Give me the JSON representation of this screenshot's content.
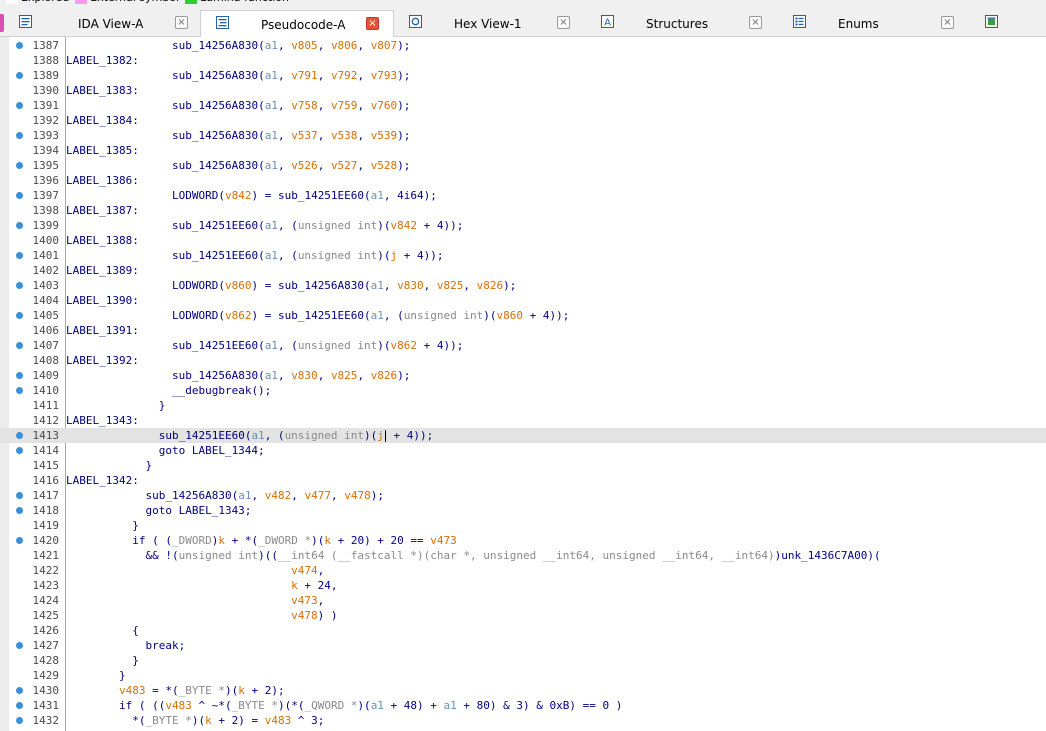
{
  "legend": {
    "items": [
      {
        "label": "Explored",
        "color": "#ffffff"
      },
      {
        "label": "External symbol",
        "color": "#ff99ee"
      },
      {
        "label": "Lumina function",
        "color": "#33cc33"
      }
    ]
  },
  "tabs": [
    {
      "label": "IDA View-A",
      "icon": "disassembly-view-icon",
      "active": false,
      "close": "×"
    },
    {
      "label": "Pseudocode-A",
      "icon": "pseudocode-icon",
      "active": true,
      "close": "×"
    },
    {
      "label": "Hex View-1",
      "icon": "hex-view-icon",
      "active": false,
      "close": "×"
    },
    {
      "label": "Structures",
      "icon": "structures-icon",
      "active": false,
      "close": "×"
    },
    {
      "label": "Enums",
      "icon": "enums-icon",
      "active": false,
      "close": "×"
    },
    {
      "label": "",
      "icon": "imports-icon",
      "active": false,
      "close": ""
    }
  ],
  "colors": {
    "dot": "#3b8fd6",
    "code": "#000080",
    "variable": "#d86e00",
    "argument": "#6a8fb8",
    "type": "#8a8a8a",
    "active_close": "#e8503a"
  },
  "code": {
    "highlighted_line": "1413",
    "lines": [
      {
        "ln": "1387",
        "dot": true,
        "tokens": [
          {
            "t": "                "
          },
          {
            "t": "sub_14256A830"
          },
          {
            "t": "("
          },
          {
            "t": "a1",
            "c": "a"
          },
          {
            "t": ", "
          },
          {
            "t": "v805",
            "c": "v"
          },
          {
            "t": ", "
          },
          {
            "t": "v806",
            "c": "v"
          },
          {
            "t": ", "
          },
          {
            "t": "v807",
            "c": "v"
          },
          {
            "t": ");"
          }
        ]
      },
      {
        "ln": "1388",
        "dot": false,
        "tokens": [
          {
            "t": "LABEL_1382:"
          }
        ]
      },
      {
        "ln": "1389",
        "dot": true,
        "tokens": [
          {
            "t": "                "
          },
          {
            "t": "sub_14256A830"
          },
          {
            "t": "("
          },
          {
            "t": "a1",
            "c": "a"
          },
          {
            "t": ", "
          },
          {
            "t": "v791",
            "c": "v"
          },
          {
            "t": ", "
          },
          {
            "t": "v792",
            "c": "v"
          },
          {
            "t": ", "
          },
          {
            "t": "v793",
            "c": "v"
          },
          {
            "t": ");"
          }
        ]
      },
      {
        "ln": "1390",
        "dot": false,
        "tokens": [
          {
            "t": "LABEL_1383:"
          }
        ]
      },
      {
        "ln": "1391",
        "dot": true,
        "tokens": [
          {
            "t": "                "
          },
          {
            "t": "sub_14256A830"
          },
          {
            "t": "("
          },
          {
            "t": "a1",
            "c": "a"
          },
          {
            "t": ", "
          },
          {
            "t": "v758",
            "c": "v"
          },
          {
            "t": ", "
          },
          {
            "t": "v759",
            "c": "v"
          },
          {
            "t": ", "
          },
          {
            "t": "v760",
            "c": "v"
          },
          {
            "t": ");"
          }
        ]
      },
      {
        "ln": "1392",
        "dot": false,
        "tokens": [
          {
            "t": "LABEL_1384:"
          }
        ]
      },
      {
        "ln": "1393",
        "dot": true,
        "tokens": [
          {
            "t": "                "
          },
          {
            "t": "sub_14256A830"
          },
          {
            "t": "("
          },
          {
            "t": "a1",
            "c": "a"
          },
          {
            "t": ", "
          },
          {
            "t": "v537",
            "c": "v"
          },
          {
            "t": ", "
          },
          {
            "t": "v538",
            "c": "v"
          },
          {
            "t": ", "
          },
          {
            "t": "v539",
            "c": "v"
          },
          {
            "t": ");"
          }
        ]
      },
      {
        "ln": "1394",
        "dot": false,
        "tokens": [
          {
            "t": "LABEL_1385:"
          }
        ]
      },
      {
        "ln": "1395",
        "dot": true,
        "tokens": [
          {
            "t": "                "
          },
          {
            "t": "sub_14256A830"
          },
          {
            "t": "("
          },
          {
            "t": "a1",
            "c": "a"
          },
          {
            "t": ", "
          },
          {
            "t": "v526",
            "c": "v"
          },
          {
            "t": ", "
          },
          {
            "t": "v527",
            "c": "v"
          },
          {
            "t": ", "
          },
          {
            "t": "v528",
            "c": "v"
          },
          {
            "t": ");"
          }
        ]
      },
      {
        "ln": "1396",
        "dot": false,
        "tokens": [
          {
            "t": "LABEL_1386:"
          }
        ]
      },
      {
        "ln": "1397",
        "dot": true,
        "tokens": [
          {
            "t": "                "
          },
          {
            "t": "LODWORD("
          },
          {
            "t": "v842",
            "c": "v"
          },
          {
            "t": ") = "
          },
          {
            "t": "sub_14251EE60"
          },
          {
            "t": "("
          },
          {
            "t": "a1",
            "c": "a"
          },
          {
            "t": ", 4i64);"
          }
        ]
      },
      {
        "ln": "1398",
        "dot": false,
        "tokens": [
          {
            "t": "LABEL_1387:"
          }
        ]
      },
      {
        "ln": "1399",
        "dot": true,
        "tokens": [
          {
            "t": "                "
          },
          {
            "t": "sub_14251EE60"
          },
          {
            "t": "("
          },
          {
            "t": "a1",
            "c": "a"
          },
          {
            "t": ", ("
          },
          {
            "t": "unsigned int",
            "c": "g"
          },
          {
            "t": ")("
          },
          {
            "t": "v842",
            "c": "v"
          },
          {
            "t": " + 4));"
          }
        ]
      },
      {
        "ln": "1400",
        "dot": false,
        "tokens": [
          {
            "t": "LABEL_1388:"
          }
        ]
      },
      {
        "ln": "1401",
        "dot": true,
        "tokens": [
          {
            "t": "                "
          },
          {
            "t": "sub_14251EE60"
          },
          {
            "t": "("
          },
          {
            "t": "a1",
            "c": "a"
          },
          {
            "t": ", ("
          },
          {
            "t": "unsigned int",
            "c": "g"
          },
          {
            "t": ")("
          },
          {
            "t": "j",
            "c": "v"
          },
          {
            "t": " + 4));"
          }
        ]
      },
      {
        "ln": "1402",
        "dot": false,
        "tokens": [
          {
            "t": "LABEL_1389:"
          }
        ]
      },
      {
        "ln": "1403",
        "dot": true,
        "tokens": [
          {
            "t": "                "
          },
          {
            "t": "LODWORD("
          },
          {
            "t": "v860",
            "c": "v"
          },
          {
            "t": ") = "
          },
          {
            "t": "sub_14256A830"
          },
          {
            "t": "("
          },
          {
            "t": "a1",
            "c": "a"
          },
          {
            "t": ", "
          },
          {
            "t": "v830",
            "c": "v"
          },
          {
            "t": ", "
          },
          {
            "t": "v825",
            "c": "v"
          },
          {
            "t": ", "
          },
          {
            "t": "v826",
            "c": "v"
          },
          {
            "t": ");"
          }
        ]
      },
      {
        "ln": "1404",
        "dot": false,
        "tokens": [
          {
            "t": "LABEL_1390:"
          }
        ]
      },
      {
        "ln": "1405",
        "dot": true,
        "tokens": [
          {
            "t": "                "
          },
          {
            "t": "LODWORD("
          },
          {
            "t": "v862",
            "c": "v"
          },
          {
            "t": ") = "
          },
          {
            "t": "sub_14251EE60"
          },
          {
            "t": "("
          },
          {
            "t": "a1",
            "c": "a"
          },
          {
            "t": ", ("
          },
          {
            "t": "unsigned int",
            "c": "g"
          },
          {
            "t": ")("
          },
          {
            "t": "v860",
            "c": "v"
          },
          {
            "t": " + 4));"
          }
        ]
      },
      {
        "ln": "1406",
        "dot": false,
        "tokens": [
          {
            "t": "LABEL_1391:"
          }
        ]
      },
      {
        "ln": "1407",
        "dot": true,
        "tokens": [
          {
            "t": "                "
          },
          {
            "t": "sub_14251EE60"
          },
          {
            "t": "("
          },
          {
            "t": "a1",
            "c": "a"
          },
          {
            "t": ", ("
          },
          {
            "t": "unsigned int",
            "c": "g"
          },
          {
            "t": ")("
          },
          {
            "t": "v862",
            "c": "v"
          },
          {
            "t": " + 4));"
          }
        ]
      },
      {
        "ln": "1408",
        "dot": false,
        "tokens": [
          {
            "t": "LABEL_1392:"
          }
        ]
      },
      {
        "ln": "1409",
        "dot": true,
        "tokens": [
          {
            "t": "                "
          },
          {
            "t": "sub_14256A830"
          },
          {
            "t": "("
          },
          {
            "t": "a1",
            "c": "a"
          },
          {
            "t": ", "
          },
          {
            "t": "v830",
            "c": "v"
          },
          {
            "t": ", "
          },
          {
            "t": "v825",
            "c": "v"
          },
          {
            "t": ", "
          },
          {
            "t": "v826",
            "c": "v"
          },
          {
            "t": ");"
          }
        ]
      },
      {
        "ln": "1410",
        "dot": true,
        "tokens": [
          {
            "t": "                "
          },
          {
            "t": "__debugbreak();"
          }
        ]
      },
      {
        "ln": "1411",
        "dot": false,
        "tokens": [
          {
            "t": "              }"
          }
        ]
      },
      {
        "ln": "1412",
        "dot": false,
        "tokens": [
          {
            "t": "LABEL_1343:"
          }
        ]
      },
      {
        "ln": "1413",
        "dot": true,
        "tokens": [
          {
            "t": "              "
          },
          {
            "t": "sub_14251EE60"
          },
          {
            "t": "("
          },
          {
            "t": "a1",
            "c": "a"
          },
          {
            "t": ", ("
          },
          {
            "t": "unsigned int",
            "c": "g"
          },
          {
            "t": ")("
          },
          {
            "t": "j",
            "c": "v"
          },
          {
            "t": "",
            "caret": true
          },
          {
            "t": " + 4));"
          }
        ]
      },
      {
        "ln": "1414",
        "dot": true,
        "tokens": [
          {
            "t": "              goto LABEL_1344;"
          }
        ]
      },
      {
        "ln": "1415",
        "dot": false,
        "tokens": [
          {
            "t": "            }"
          }
        ]
      },
      {
        "ln": "1416",
        "dot": false,
        "tokens": [
          {
            "t": "LABEL_1342:"
          }
        ]
      },
      {
        "ln": "1417",
        "dot": true,
        "tokens": [
          {
            "t": "            "
          },
          {
            "t": "sub_14256A830"
          },
          {
            "t": "("
          },
          {
            "t": "a1",
            "c": "a"
          },
          {
            "t": ", "
          },
          {
            "t": "v482",
            "c": "v"
          },
          {
            "t": ", "
          },
          {
            "t": "v477",
            "c": "v"
          },
          {
            "t": ", "
          },
          {
            "t": "v478",
            "c": "v"
          },
          {
            "t": ");"
          }
        ]
      },
      {
        "ln": "1418",
        "dot": true,
        "tokens": [
          {
            "t": "            goto LABEL_1343;"
          }
        ]
      },
      {
        "ln": "1419",
        "dot": false,
        "tokens": [
          {
            "t": "          }"
          }
        ]
      },
      {
        "ln": "1420",
        "dot": true,
        "tokens": [
          {
            "t": "          if ( ("
          },
          {
            "t": "_DWORD",
            "c": "g"
          },
          {
            "t": ")"
          },
          {
            "t": "k",
            "c": "v"
          },
          {
            "t": " + *("
          },
          {
            "t": "_DWORD *",
            "c": "g"
          },
          {
            "t": ")("
          },
          {
            "t": "k",
            "c": "v"
          },
          {
            "t": " + 20) + 20 == "
          },
          {
            "t": "v473",
            "c": "v"
          }
        ]
      },
      {
        "ln": "1421",
        "dot": false,
        "tokens": [
          {
            "t": "            && !("
          },
          {
            "t": "unsigned int",
            "c": "g"
          },
          {
            "t": ")(("
          },
          {
            "t": "__int64 (__fastcall *)(char *, unsigned __int64, unsigned __int64, __int64)",
            "c": "g"
          },
          {
            "t": ")unk_1436C7A00)("
          }
        ]
      },
      {
        "ln": "1422",
        "dot": false,
        "tokens": [
          {
            "t": "                                  "
          },
          {
            "t": "v474",
            "c": "v"
          },
          {
            "t": ","
          }
        ]
      },
      {
        "ln": "1423",
        "dot": false,
        "tokens": [
          {
            "t": "                                  "
          },
          {
            "t": "k",
            "c": "v"
          },
          {
            "t": " + 24,"
          }
        ]
      },
      {
        "ln": "1424",
        "dot": false,
        "tokens": [
          {
            "t": "                                  "
          },
          {
            "t": "v473",
            "c": "v"
          },
          {
            "t": ","
          }
        ]
      },
      {
        "ln": "1425",
        "dot": false,
        "tokens": [
          {
            "t": "                                  "
          },
          {
            "t": "v478",
            "c": "v"
          },
          {
            "t": ") )"
          }
        ]
      },
      {
        "ln": "1426",
        "dot": false,
        "tokens": [
          {
            "t": "          {"
          }
        ]
      },
      {
        "ln": "1427",
        "dot": true,
        "tokens": [
          {
            "t": "            break;"
          }
        ]
      },
      {
        "ln": "1428",
        "dot": false,
        "tokens": [
          {
            "t": "          }"
          }
        ]
      },
      {
        "ln": "1429",
        "dot": false,
        "tokens": [
          {
            "t": "        }"
          }
        ]
      },
      {
        "ln": "1430",
        "dot": true,
        "tokens": [
          {
            "t": "        "
          },
          {
            "t": "v483",
            "c": "v"
          },
          {
            "t": " = *("
          },
          {
            "t": "_BYTE *",
            "c": "g"
          },
          {
            "t": ")("
          },
          {
            "t": "k",
            "c": "v"
          },
          {
            "t": " + 2);"
          }
        ]
      },
      {
        "ln": "1431",
        "dot": true,
        "tokens": [
          {
            "t": "        if ( (("
          },
          {
            "t": "v483",
            "c": "v"
          },
          {
            "t": " ^ ~*("
          },
          {
            "t": "_BYTE *",
            "c": "g"
          },
          {
            "t": ")(*("
          },
          {
            "t": "_QWORD *",
            "c": "g"
          },
          {
            "t": ")("
          },
          {
            "t": "a1",
            "c": "a"
          },
          {
            "t": " + 48) + "
          },
          {
            "t": "a1",
            "c": "a"
          },
          {
            "t": " + 80) & 3) & 0xB) == 0 )"
          }
        ]
      },
      {
        "ln": "1432",
        "dot": true,
        "tokens": [
          {
            "t": "          *("
          },
          {
            "t": "_BYTE *",
            "c": "g"
          },
          {
            "t": ")("
          },
          {
            "t": "k",
            "c": "v"
          },
          {
            "t": " + 2) = "
          },
          {
            "t": "v483",
            "c": "v"
          },
          {
            "t": " ^ 3;"
          }
        ]
      }
    ]
  }
}
